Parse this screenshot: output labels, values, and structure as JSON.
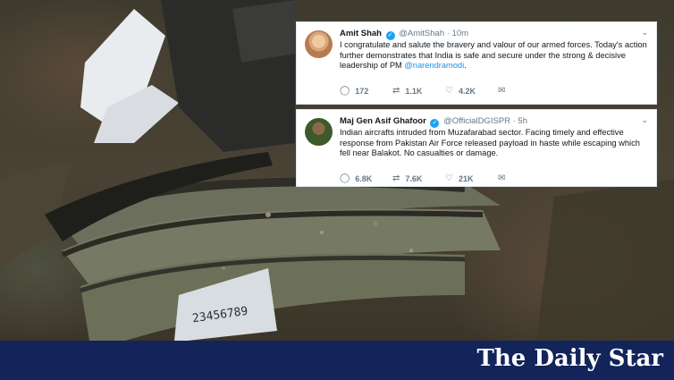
{
  "tweets": [
    {
      "name": "Amit Shah",
      "handle": "@AmitShah · 10m",
      "text_main": "I congratulate and salute the bravery and valour of our armed forces. Today's action further demonstrates that India is safe and secure under the strong & decisive leadership of PM ",
      "mention": "@narendramodi",
      "text_end": ".",
      "reply_count": "172",
      "retweet_count": "1.1K",
      "like_count": "4.2K"
    },
    {
      "name": "Maj Gen Asif Ghafoor",
      "handle": "@OfficialDGISPR · 5h",
      "text_main": "Indian aircrafts intruded from Muzafarabad sector. Facing timely and effective response from Pakistan Air Force released payload in haste while escaping which fell near Balakot. No casualties or damage.",
      "mention": "",
      "text_end": "",
      "reply_count": "6.8K",
      "retweet_count": "7.6K",
      "like_count": "21K"
    }
  ],
  "photo": {
    "label_number": "23456789"
  },
  "footer": {
    "brand": "The Daily Star"
  },
  "icons": {
    "verified": "verified-badge-icon",
    "reply": "reply-icon",
    "retweet": "retweet-icon",
    "like": "heart-icon",
    "dm": "envelope-icon",
    "more": "chevron-down-icon"
  },
  "colors": {
    "link": "#1b95e0",
    "verified": "#1da1f2",
    "footer_bg": "#12245a"
  }
}
